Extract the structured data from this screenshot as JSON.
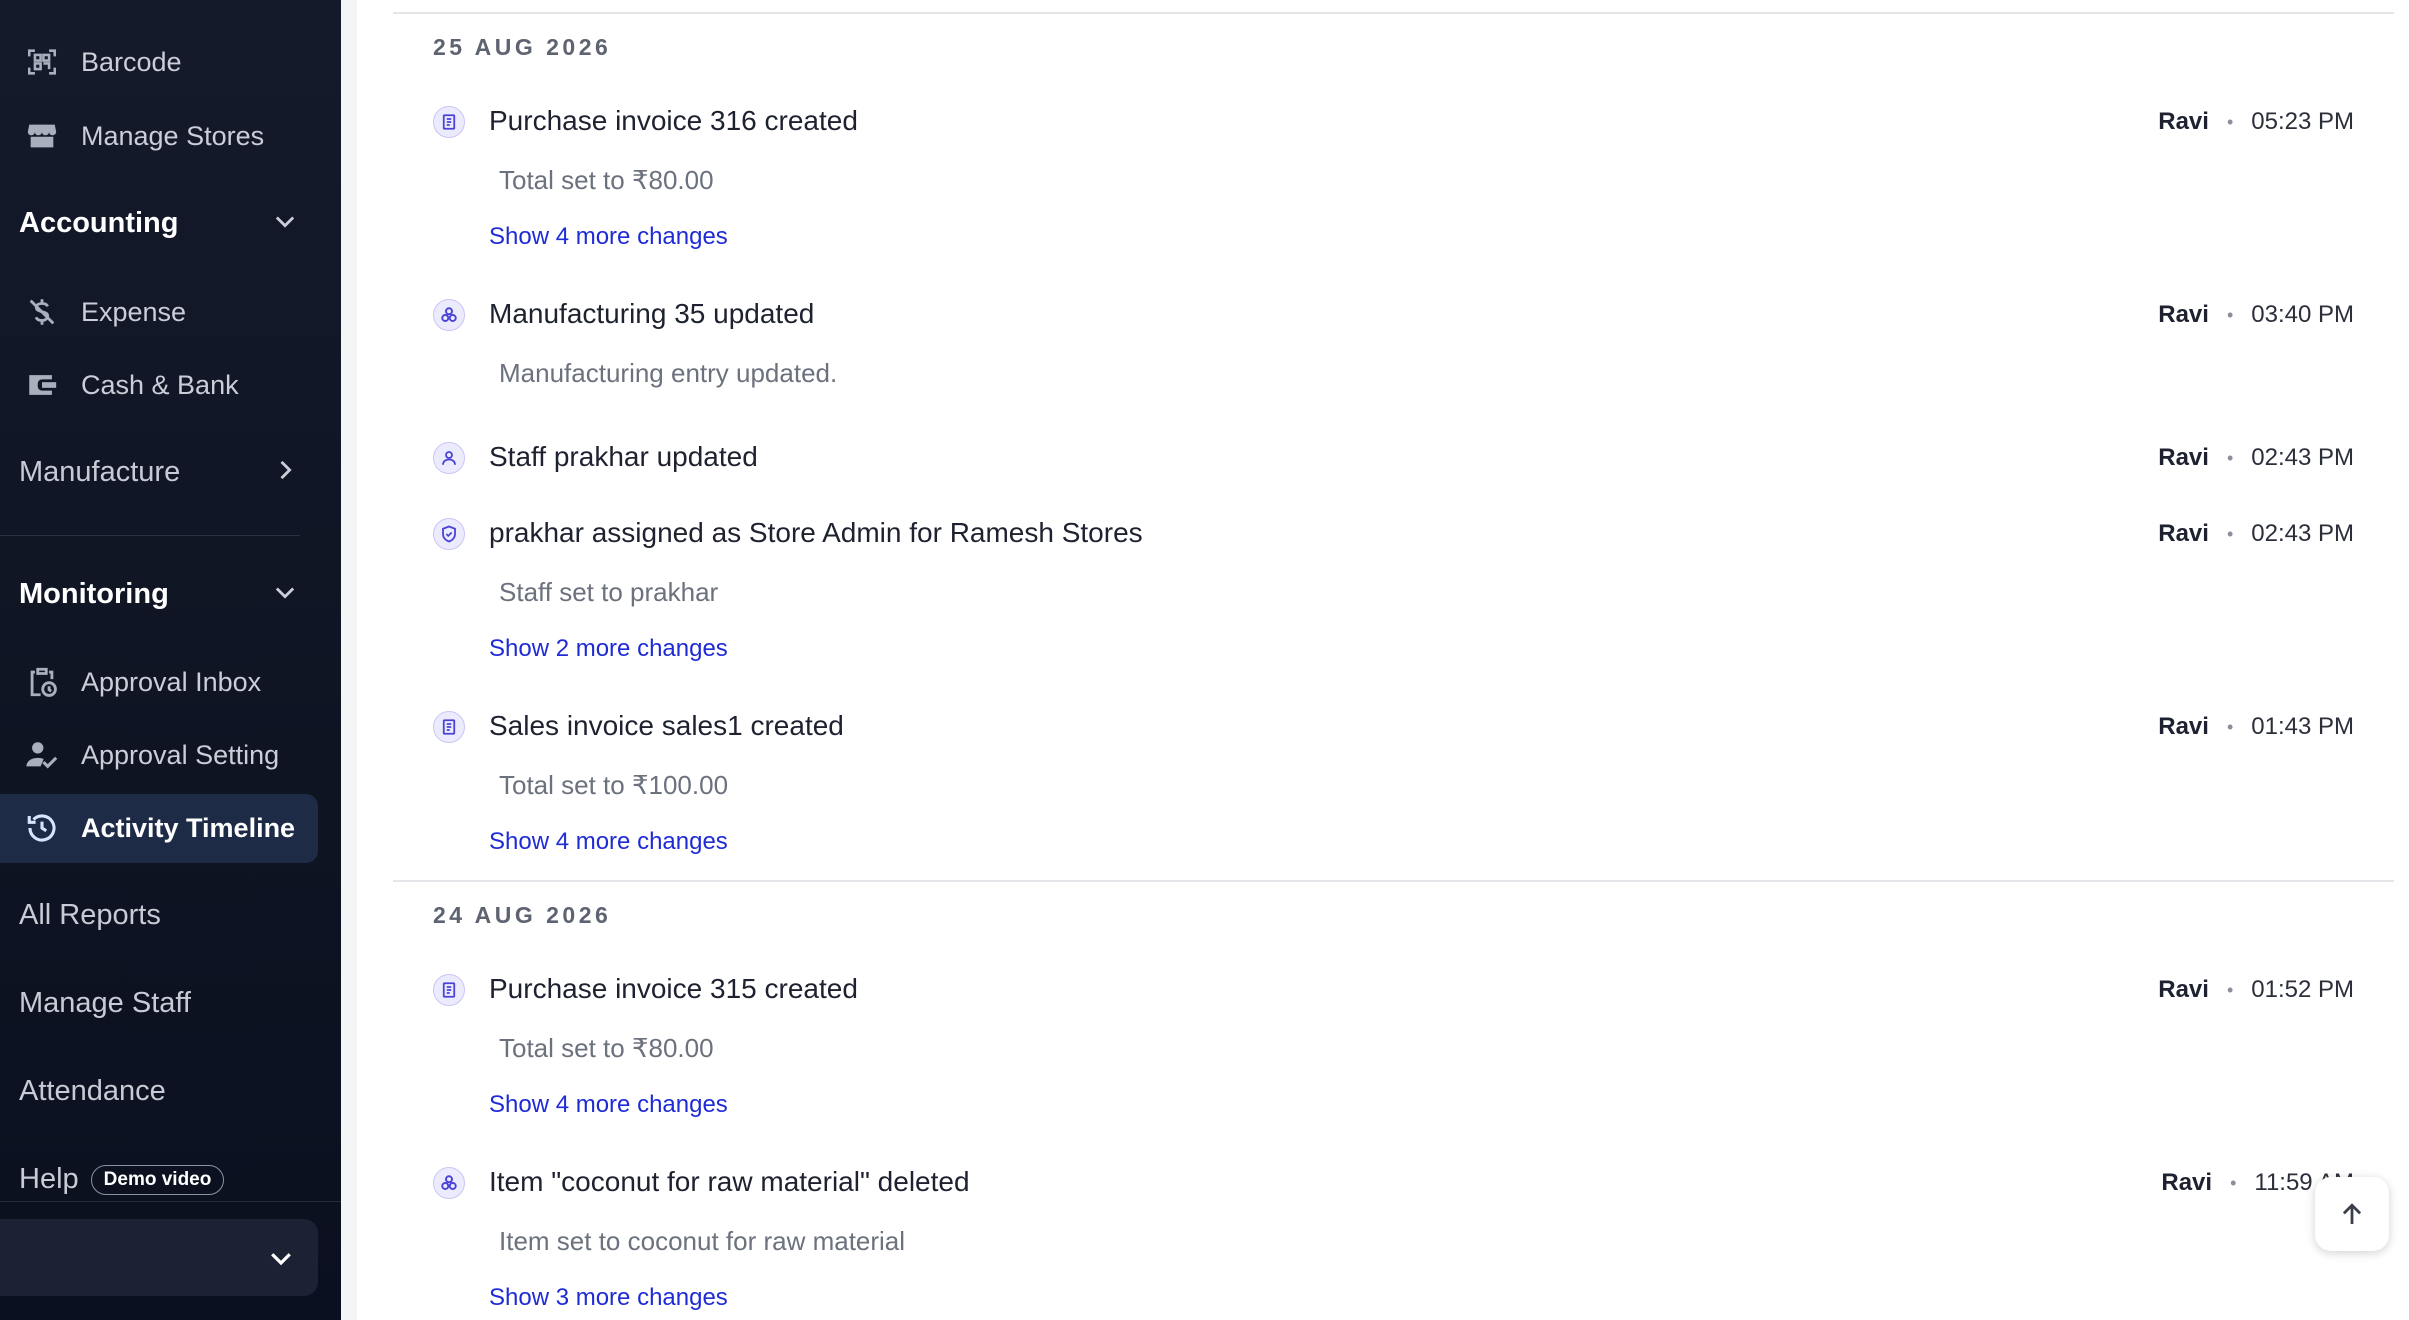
{
  "sidebar": {
    "items_top": [
      {
        "label": "Barcode",
        "icon": "barcode-icon"
      },
      {
        "label": "Manage Stores",
        "icon": "store-icon"
      }
    ],
    "accounting": {
      "label": "Accounting",
      "items": [
        {
          "label": "Expense",
          "icon": "no-money-icon"
        },
        {
          "label": "Cash & Bank",
          "icon": "wallet-icon"
        }
      ]
    },
    "manufacture": {
      "label": "Manufacture"
    },
    "monitoring": {
      "label": "Monitoring",
      "items": [
        {
          "label": "Approval Inbox",
          "icon": "clipboard-clock-icon"
        },
        {
          "label": "Approval Setting",
          "icon": "person-check-icon"
        },
        {
          "label": "Activity Timeline",
          "icon": "history-icon",
          "active": true
        }
      ]
    },
    "links": {
      "all_reports": "All Reports",
      "manage_staff": "Manage Staff",
      "attendance": "Attendance",
      "help": "Help",
      "demo_badge": "Demo video"
    }
  },
  "timeline": {
    "groups": [
      {
        "date": "25 AUG 2026",
        "entries": [
          {
            "icon": "invoice-icon",
            "title": "Purchase invoice 316 created",
            "user": "Ravi",
            "time": "05:23 PM",
            "detail": "Total set to ₹80.00",
            "more": "Show 4 more changes"
          },
          {
            "icon": "manufacturing-icon",
            "title": "Manufacturing 35 updated",
            "user": "Ravi",
            "time": "03:40 PM",
            "detail": "Manufacturing entry updated.",
            "more": ""
          },
          {
            "icon": "user-icon",
            "title": "Staff prakhar updated",
            "user": "Ravi",
            "time": "02:43 PM",
            "detail": "",
            "more": ""
          },
          {
            "icon": "shield-icon",
            "title": "prakhar assigned as Store Admin for Ramesh Stores",
            "user": "Ravi",
            "time": "02:43 PM",
            "detail": "Staff set to prakhar",
            "more": "Show 2 more changes"
          },
          {
            "icon": "invoice-icon",
            "title": "Sales invoice sales1 created",
            "user": "Ravi",
            "time": "01:43 PM",
            "detail": "Total set to ₹100.00",
            "more": "Show 4 more changes"
          }
        ]
      },
      {
        "date": "24 AUG 2026",
        "entries": [
          {
            "icon": "invoice-icon",
            "title": "Purchase invoice 315 created",
            "user": "Ravi",
            "time": "01:52 PM",
            "detail": "Total set to ₹80.00",
            "more": "Show 4 more changes"
          },
          {
            "icon": "manufacturing-icon",
            "title": "Item \"coconut for raw material\" deleted",
            "user": "Ravi",
            "time": "11:59 AM",
            "detail": "Item set to coconut for raw material",
            "more": "Show 3 more changes"
          }
        ]
      }
    ],
    "separator": "•"
  },
  "colors": {
    "sidebar_bg": "#0e1422",
    "active_bg": "#1d2b47",
    "link": "#1f2bd6",
    "icon_bg": "#ecebfd",
    "icon_fg": "#4b43d6"
  }
}
